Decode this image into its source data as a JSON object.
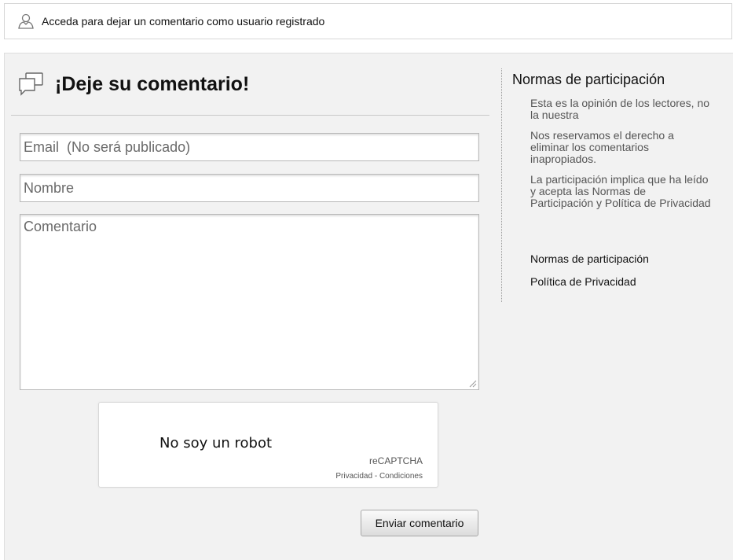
{
  "login_bar": {
    "icon": "user-icon",
    "text": "Acceda para dejar un comentario como usuario registrado"
  },
  "comment_form": {
    "icon": "speech-bubbles-icon",
    "title": "¡Deje su comentario!",
    "email_placeholder": "Email  (No será publicado)",
    "name_placeholder": "Nombre",
    "comment_placeholder": "Comentario",
    "captcha": {
      "label": "No soy un robot",
      "brand": "reCAPTCHA",
      "privacy": "Privacidad",
      "separator": " - ",
      "terms": "Condiciones"
    },
    "submit_label": "Enviar comentario"
  },
  "sidebar": {
    "title": "Normas de participación",
    "rules": [
      "Esta es la opinión de los lectores, no la nuestra",
      "Nos reservamos el derecho a eliminar los comentarios inapropiados.",
      "La participación implica que ha leído y acepta las Normas de Participación y Política de Privacidad"
    ],
    "link_rules": "Normas de participación",
    "link_privacy": "Política de Privacidad"
  }
}
